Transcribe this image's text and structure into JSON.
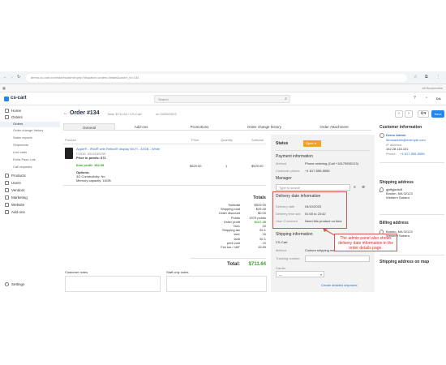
{
  "browser": {
    "url": "demo.cs-cart.com/stores/admin.php?dispatch=orders.details&order_id=134",
    "all_bookmarks": "All Bookmarks"
  },
  "app": {
    "logo": "cs-cart",
    "search_placeholder": "Search",
    "user_initials": "DA"
  },
  "sidebar": {
    "items": [
      {
        "label": "Home",
        "icon": "home-icon"
      },
      {
        "label": "Orders",
        "icon": "orders-icon"
      },
      {
        "label": "Products",
        "icon": "products-icon"
      },
      {
        "label": "Users",
        "icon": "users-icon"
      },
      {
        "label": "Vendors",
        "icon": "vendors-icon"
      },
      {
        "label": "Marketing",
        "icon": "marketing-icon"
      },
      {
        "label": "Website",
        "icon": "website-icon"
      },
      {
        "label": "Add-ons",
        "icon": "addons-icon"
      }
    ],
    "order_subitems": [
      "Orders",
      "Order change history",
      "Sales reports",
      "Shipments",
      "Live carts",
      "Extra Pass Link",
      "Call requests"
    ],
    "settings": "Settings"
  },
  "order": {
    "title": "Order #134",
    "subtitle": "Total: $711.64 / CS-Cart",
    "date": "on 04/05/2023",
    "save_label": "Save",
    "tabs": [
      "General",
      "Add-ons",
      "Promotions",
      "Order change history",
      "Order Attachment"
    ]
  },
  "products_table": {
    "headers": [
      "Product",
      "Price",
      "Quantity",
      "Subtotal"
    ],
    "product_name": "Apple® - iPad® with Retina® display Wi-Fi - 32GB - White",
    "code": "CODE: 0024150299",
    "price_in_points": "Price in points: 671",
    "item_profit": "Item profit: 182.08",
    "options_label": "Options:",
    "option1": "3G Connectivity: No",
    "option2": "Memory capacity: 16GB",
    "price": "$529.00",
    "quantity": "1",
    "subtotal": "$529.00"
  },
  "totals": {
    "heading": "Totals",
    "rows": [
      {
        "label": "Subtotal",
        "value": "$529.00"
      },
      {
        "label": "Shipping cost",
        "value": "$25.45"
      },
      {
        "label": "Order discount",
        "value": "$0.00"
      },
      {
        "label": "Points",
        "value": "1970 points"
      },
      {
        "label": "Order profit",
        "value": "$127.45"
      },
      {
        "label": "Tax1",
        "value": "20"
      },
      {
        "label": "Shipping tax",
        "value": "52.1"
      },
      {
        "label": "tax1",
        "value": "16"
      },
      {
        "label": "tax6",
        "value": "52.1"
      },
      {
        "label": "print cost",
        "value": "10"
      },
      {
        "label": "Fee tax / VAT",
        "value": "15.89"
      }
    ],
    "total_label": "Total:",
    "total_value": "$711.64"
  },
  "notes": {
    "customer_notes": "Customer notes",
    "staff_notes": "Staff only notes"
  },
  "status_panel": {
    "status_label": "Status",
    "status_value": "Open",
    "payment_heading": "Payment information",
    "method_label": "Method",
    "method_value": "Phone ordering (Call +16175550123)",
    "phone_label": "Customer phone",
    "phone_value": "+1 617-555-5555",
    "manager_heading": "Manager",
    "manager_placeholder": "Type to search",
    "delivery_heading": "Delivery date information",
    "delivery_date_label": "Delivery date",
    "delivery_date_value": "04/10/2023",
    "delivery_time_label": "Delivery time slot",
    "delivery_time_value": "01:00 to 23:42",
    "user_comment_label": "User Comment",
    "user_comment_value": "Need this product on time",
    "shipping_heading": "Shipping information",
    "shipping_cs_cart": "CS-Cart",
    "shipping_method_label": "Method",
    "shipping_method_value": "Custom shipping me...",
    "tracking_label": "Tracking number",
    "carrier_label": "Carrier",
    "carrier_value": "---",
    "create_shipment": "Create detailed shipment"
  },
  "customer": {
    "heading": "Customer information",
    "name": "Demo Admin",
    "email": "demoadmin@example.com",
    "ip_label": "IP address:",
    "ip": "162.28.118.101",
    "phone_label": "Phone:",
    "phone": "+1 617-555-5555",
    "shipping_heading": "Shipping address",
    "shipping_lines": [
      "gjsffgjsdsdf",
      "Boston, MA 02123",
      "Western Sahara"
    ],
    "billing_heading": "Billing address",
    "billing_lines": [
      "Boston, MA 02123",
      "Western Sahara"
    ],
    "map_heading": "Shipping address on map"
  },
  "annotation": {
    "text": "The admin panel also shows delivery date information in the order details page."
  },
  "colors": {
    "accent": "#1f86f0",
    "status_orange": "#f0a032",
    "annotation_red": "#d9534f",
    "profit_green": "#3e9b2f"
  }
}
